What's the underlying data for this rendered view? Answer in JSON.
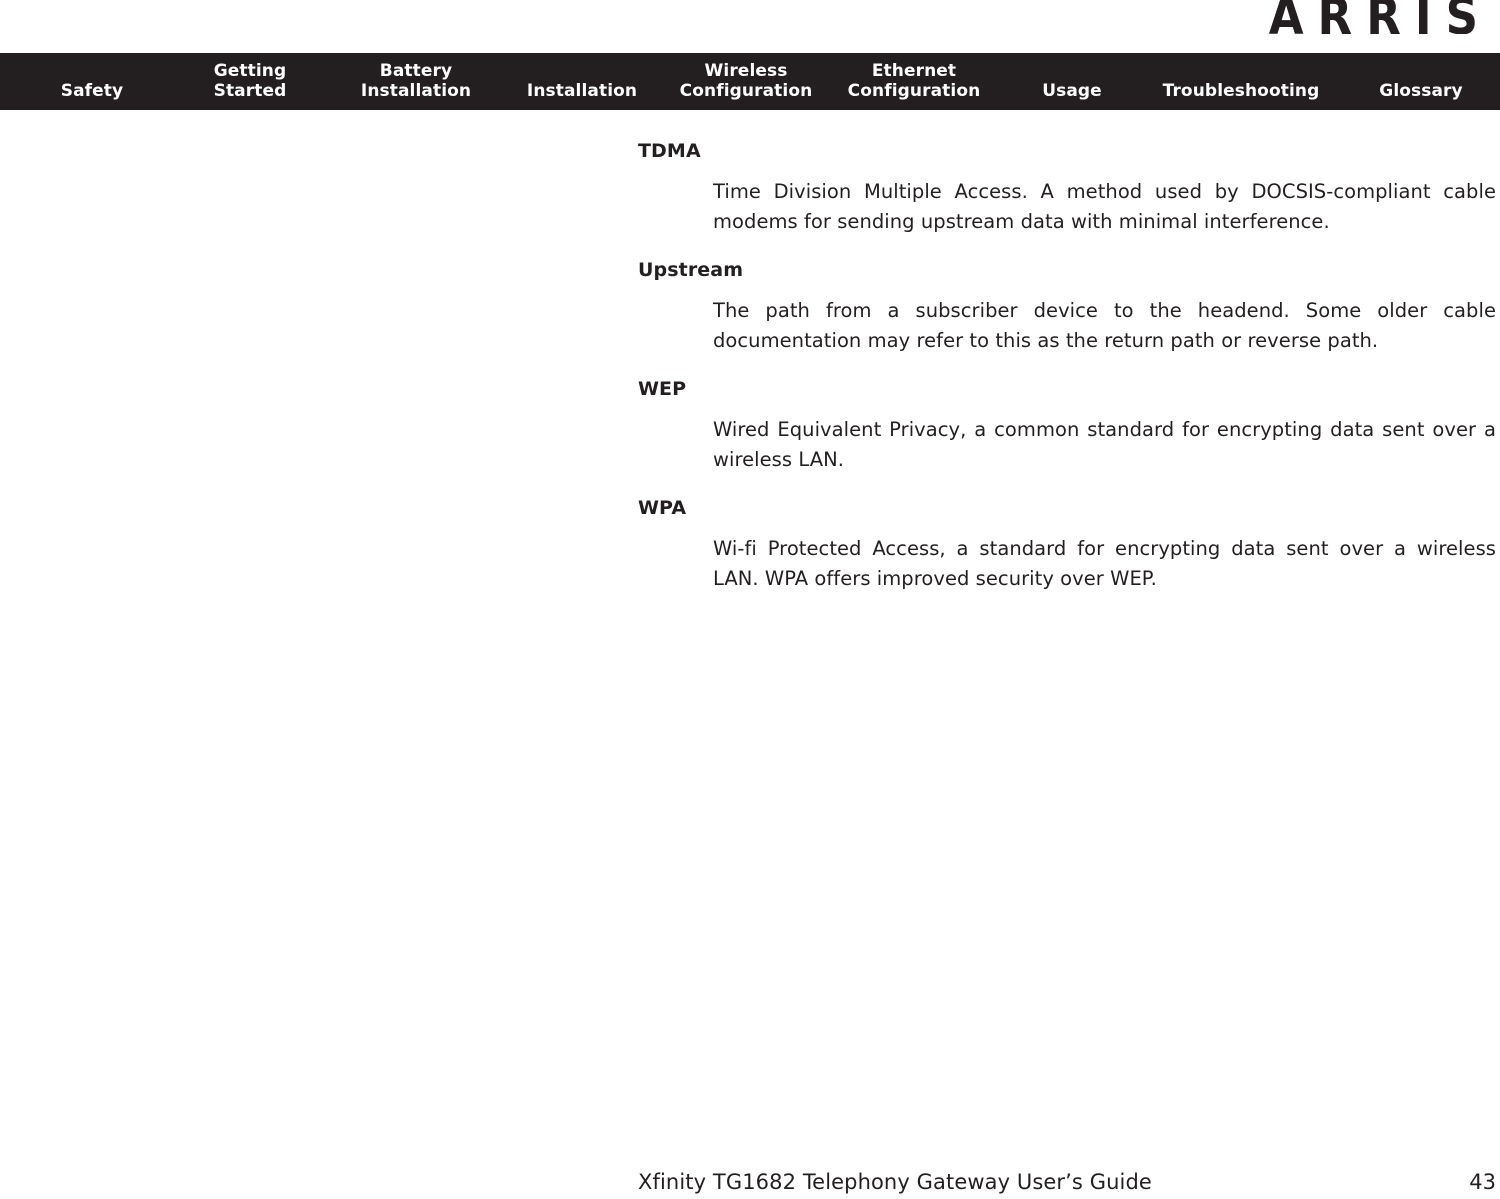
{
  "brand": {
    "logo_text": "ARRIS",
    "logo_icon": "arris-wordmark-logo"
  },
  "nav": {
    "items": [
      {
        "label": "Safety",
        "name": "nav-item-safety"
      },
      {
        "label": "Getting\nStarted",
        "name": "nav-item-getting-started"
      },
      {
        "label": "Battery\nInstallation",
        "name": "nav-item-battery-installation"
      },
      {
        "label": "Installation",
        "name": "nav-item-installation"
      },
      {
        "label": "Wireless\nConfiguration",
        "name": "nav-item-wireless-configuration"
      },
      {
        "label": "Ethernet\nConfiguration",
        "name": "nav-item-ethernet-configuration"
      },
      {
        "label": "Usage",
        "name": "nav-item-usage"
      },
      {
        "label": "Troubleshooting",
        "name": "nav-item-troubleshooting"
      },
      {
        "label": "Glossary",
        "name": "nav-item-glossary"
      }
    ],
    "background_color": "#231f20",
    "text_color": "#ffffff"
  },
  "content": {
    "entries": [
      {
        "term": "TDMA",
        "definition": "Time Division Multiple Access. A method used by DOCSIS-compliant cable modems for sending upstream data with minimal interference."
      },
      {
        "term": "Upstream",
        "definition": "The path from a subscriber device to the headend. Some older cable documentation may refer to this as the return path or reverse path."
      },
      {
        "term": "WEP",
        "definition": "Wired Equivalent Privacy, a common standard for encrypting data sent over a wireless LAN."
      },
      {
        "term": "WPA",
        "definition": "Wi-fi Protected Access, a standard for encrypting data sent over a wireless LAN. WPA offers improved security over WEP."
      }
    ]
  },
  "footer": {
    "title": "Xfinity TG1682 Telephony Gateway User’s Guide",
    "page_number": "43"
  }
}
